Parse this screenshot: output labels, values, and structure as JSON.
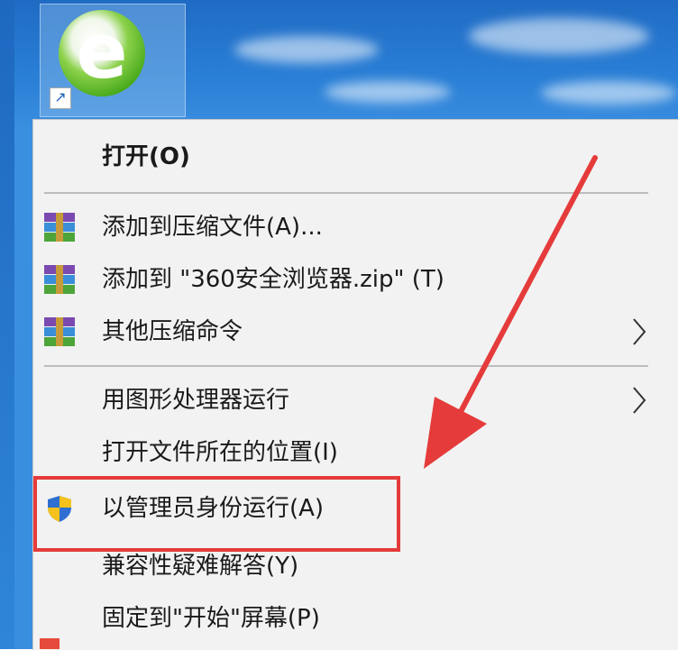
{
  "desktop": {
    "shortcut_name": "360安全浏览器"
  },
  "menu": {
    "items": [
      {
        "label": "打开(O)",
        "bold": true
      },
      {
        "label": "添加到压缩文件(A)...",
        "icon": "winrar-icon"
      },
      {
        "label": "添加到 \"360安全浏览器.zip\" (T)",
        "icon": "winrar-icon"
      },
      {
        "label": "其他压缩命令",
        "icon": "winrar-icon",
        "submenu": true
      },
      {
        "label": "用图形处理器运行",
        "submenu": true
      },
      {
        "label": "打开文件所在的位置(I)"
      },
      {
        "label": "以管理员身份运行(A)",
        "icon": "uac-shield-icon",
        "highlighted": true
      },
      {
        "label": "兼容性疑难解答(Y)"
      },
      {
        "label": "固定到\"开始\"屏幕(P)"
      }
    ]
  },
  "colors": {
    "highlight_box": "#e53b3b",
    "annotation_arrow": "#e53b3b",
    "menu_background": "#f2f2f2"
  }
}
